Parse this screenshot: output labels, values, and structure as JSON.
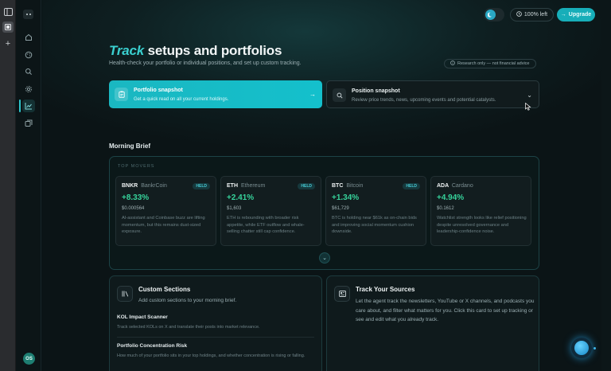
{
  "app": {
    "logo_icon": "app-logo-icon",
    "avatar_initials": "OS"
  },
  "browser_rail": {
    "icons": [
      "sidebar-toggle-icon",
      "current-tab-icon",
      "new-tab-plus-icon"
    ],
    "plus_glyph": "+"
  },
  "nav": {
    "items": [
      {
        "name": "home",
        "icon": "home-icon"
      },
      {
        "name": "explore",
        "icon": "palette-icon"
      },
      {
        "name": "search",
        "icon": "search-icon"
      },
      {
        "name": "settings",
        "icon": "gear-icon"
      },
      {
        "name": "track",
        "icon": "chart-line-icon",
        "active": true
      },
      {
        "name": "library",
        "icon": "stack-icon"
      }
    ]
  },
  "topbar": {
    "theme_icon": "moon-icon",
    "credits_label": "100% left",
    "upgrade_label": "Upgrade",
    "upgrade_arrow": "→"
  },
  "hero": {
    "title_accent": "Track",
    "title_rest": "setups and portfolios",
    "subtitle": "Health-check your portfolio or individual positions, and set up custom tracking.",
    "disclaimer": "Research only — not financial advice"
  },
  "snapshots": {
    "portfolio": {
      "title": "Portfolio snapshot",
      "description": "Get a quick read on all your current holdings.",
      "arrow": "→"
    },
    "position": {
      "title": "Position snapshot",
      "description": "Review price trends, news, upcoming events and potential catalysts.",
      "chevron": "⌄"
    }
  },
  "brief": {
    "title": "Morning Brief",
    "top_movers_label": "TOP MOVERS",
    "movers": [
      {
        "symbol": "BNKR",
        "name": "BankrCoin",
        "badge": "HELD",
        "change": "+8.33%",
        "price": "$0.000564",
        "note": "AI-assistant and Coinbase buzz are lifting momentum, but this remains dust-sized exposure."
      },
      {
        "symbol": "ETH",
        "name": "Ethereum",
        "badge": "HELD",
        "change": "+2.41%",
        "price": "$1,603",
        "note": "ETH is rebounding with broader risk appetite, while ETF outflow and whale-selling chatter still cap confidence."
      },
      {
        "symbol": "BTC",
        "name": "Bitcoin",
        "badge": "HELD",
        "change": "+1.34%",
        "price": "$61,729",
        "note": "BTC is holding near $61k as on-chain bids and improving social momentum cushion downside."
      },
      {
        "symbol": "ADA",
        "name": "Cardano",
        "badge": "",
        "change": "+4.94%",
        "price": "$0.1612",
        "note": "Watchlist strength looks like relief positioning despite unresolved governance and leadership-confidence noise."
      }
    ],
    "expand_icon": "chevron-down-icon",
    "expand_glyph": "⌄"
  },
  "custom_sections": {
    "title": "Custom Sections",
    "description": "Add custom sections to your morning brief.",
    "items": [
      {
        "title": "KOL Impact Scanner",
        "description": "Track selected KOLs on X and translate their posts into market relevance."
      },
      {
        "title": "Portfolio Concentration Risk",
        "description": "How much of your portfolio sits in your top holdings, and whether concentration is rising or falling."
      }
    ]
  },
  "sources": {
    "title": "Track Your Sources",
    "description": "Let the agent track the newsletters, YouTube or X channels, and podcasts you care about, and filter what matters for you. Click this card to set up tracking or see and edit what you already track."
  },
  "colors": {
    "accent": "#17aeb9",
    "positive": "#36d39b",
    "background": "#0b1416"
  }
}
